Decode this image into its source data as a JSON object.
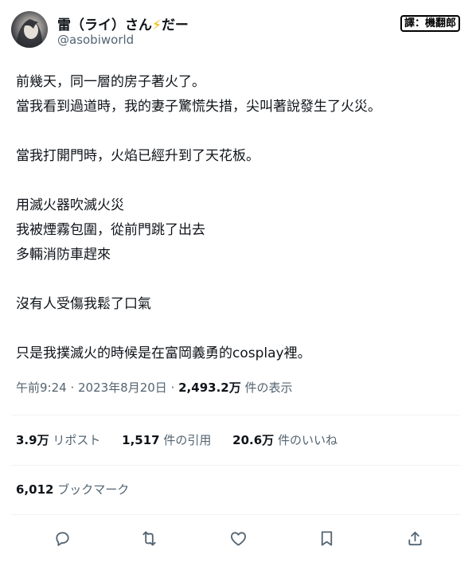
{
  "author": {
    "name": "雷（ライ）さん",
    "name_emoji": "⚡",
    "name_suffix": "だー",
    "handle": "@asobiworld"
  },
  "translator_badge": "譯：機翻郎",
  "tweet_text": "前幾天，同一層的房子著火了。\n當我看到過道時，我的妻子驚慌失措，尖叫著說發生了火災。\n\n當我打開門時，火焰已經升到了天花板。\n\n用滅火器吹滅火災\n我被煙霧包圍，從前門跳了出去\n多輛消防車趕來\n\n沒有人受傷我鬆了口氣\n\n只是我撲滅火的時候是在富岡義勇的cosplay裡。",
  "meta": {
    "time": "午前9:24",
    "sep1": " · ",
    "date": "2023年8月20日",
    "sep2": " · ",
    "views_count": "2,493.2万",
    "views_label": " 件の表示"
  },
  "stats": {
    "reposts_count": "3.9万",
    "reposts_label": " リポスト",
    "quotes_count": "1,517",
    "quotes_label": " 件の引用",
    "likes_count": "20.6万",
    "likes_label": " 件のいいね"
  },
  "bookmarks": {
    "count": "6,012",
    "label": " ブックマーク"
  },
  "actions": {
    "icons": [
      "reply-icon",
      "repost-icon",
      "like-icon",
      "bookmark-icon",
      "share-icon"
    ]
  },
  "colors": {
    "text": "#0f1419",
    "secondary": "#536471",
    "divider": "#eff3f4",
    "bolt": "#f4b400"
  }
}
